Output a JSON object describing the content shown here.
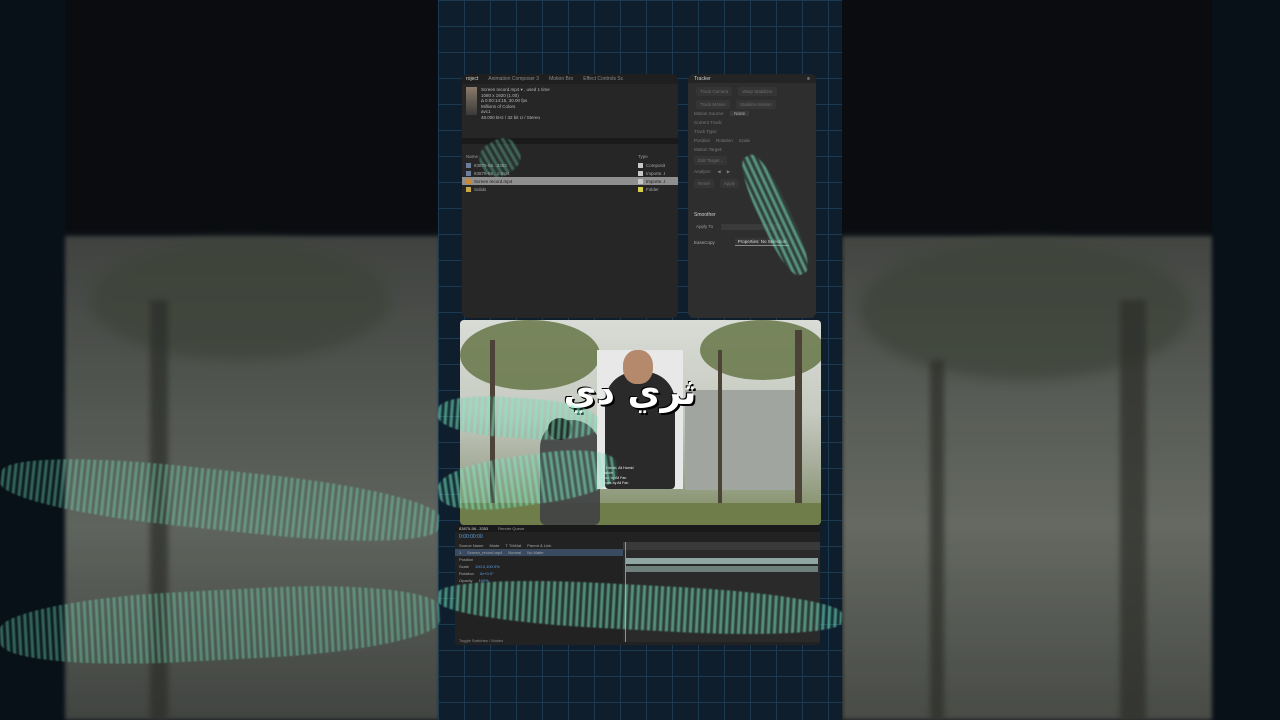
{
  "project_panel": {
    "tabs": [
      "roject",
      "Animation Composer 3",
      "Motion Bro",
      "Effect Controls Sc"
    ],
    "footage": {
      "name": "Screen record.mp4 ▾ , used 1 time",
      "resolution": "1080 x 1920 (1.00)",
      "duration": "Δ 0:00:14:15, 30.00 fps",
      "colors": "Millions of Colors",
      "codec": "avc1",
      "audio": "48.000 kHz / 32 bit U / Stereo"
    },
    "columns": {
      "name": "Name",
      "type": "Type"
    },
    "items": [
      {
        "name": "83875-58...3353",
        "type": "Composit",
        "swatch": "#c7c7c7"
      },
      {
        "name": "83875-58...1-mp4",
        "type": "Importe..t",
        "swatch": "#c7c7c7"
      },
      {
        "name": "Screen record.mp4",
        "type": "Importe..t",
        "swatch": "#c7c7c7",
        "selected": true
      },
      {
        "name": "Solids",
        "type": "Folder",
        "swatch": "#d8d24a"
      }
    ]
  },
  "tracker_panel": {
    "title": "Tracker",
    "buttons_row1": [
      "Track Camera",
      "Warp Stabilizer"
    ],
    "buttons_row2": [
      "Track Motion",
      "Stabilize Motion"
    ],
    "motion_source_label": "Motion Source:",
    "motion_source_value": "None",
    "current_track_label": "Current Track:",
    "track_type_label": "Track Type:",
    "checkbox_labels": [
      "Position",
      "Rotation",
      "Scale"
    ],
    "motion_target_label": "Motion Target:",
    "edit_target": "Edit Target...",
    "analyze_label": "Analyze:",
    "reset_label": "Reset",
    "apply_label": "Apply",
    "smoother_title": "Smoother",
    "apply_to_label": "Apply To",
    "easecopy_label": "EaseCopy",
    "easecopy_value": "Properties: No Selection"
  },
  "preview": {
    "overlay_text": "ثري دي",
    "inset_caption": [
      "Ali Hamid, Ali Hamid",
      "Cashier",
      "Prod. by Ali Fan",
      "Vocals by Ali Fan"
    ]
  },
  "timeline": {
    "tabs": [
      "83875-58...3353",
      "Render Queue"
    ],
    "timecode": "0:00:00:00",
    "rows": [
      {
        "num": "1",
        "name": "Screen_record.mp4",
        "mode": "Normal",
        "trkmat": "No Matte",
        "selected": true
      },
      {
        "num": "",
        "name": "Position",
        "value": ""
      },
      {
        "num": "",
        "name": "Scale",
        "value": "100.0,100.0%"
      },
      {
        "num": "",
        "name": "Rotation",
        "value": "0x+0.0°"
      },
      {
        "num": "",
        "name": "Opacity",
        "value": "100%"
      }
    ],
    "columns": [
      "Source Name",
      "Mode",
      "T TrkMat",
      "Parent & Link"
    ],
    "footer": "Toggle Switches / Modes"
  }
}
